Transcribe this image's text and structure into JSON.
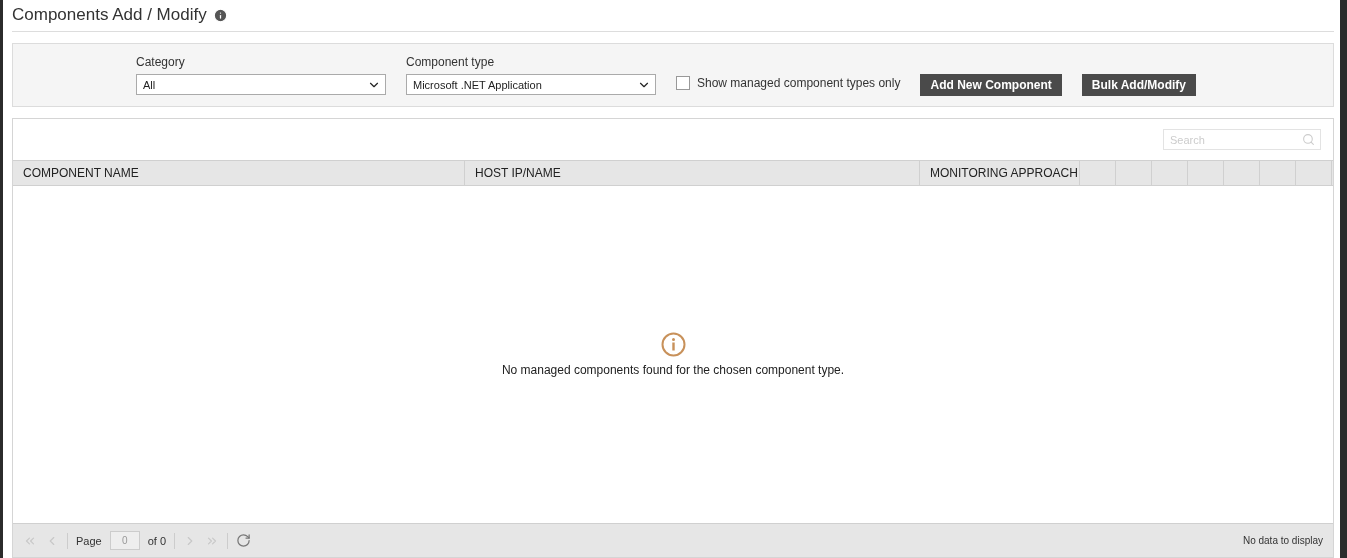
{
  "title": "Components Add / Modify",
  "filters": {
    "category": {
      "label": "Category",
      "value": "All"
    },
    "component_type": {
      "label": "Component type",
      "value": "Microsoft .NET Application"
    },
    "managed_only": {
      "label": "Show managed component types only",
      "checked": false
    },
    "buttons": [
      "Add New Component",
      "Bulk Add/Modify"
    ]
  },
  "table": {
    "search": {
      "placeholder": "Search"
    },
    "columns": [
      {
        "label": "COMPONENT NAME"
      },
      {
        "label": "HOST IP/NAME"
      },
      {
        "label": "MONITORING APPROACH"
      }
    ],
    "empty_message": "No managed components found for the chosen component type."
  },
  "pager": {
    "page_label": "Page",
    "page_value": "0",
    "of_label": "of 0",
    "status": "No data to display"
  }
}
